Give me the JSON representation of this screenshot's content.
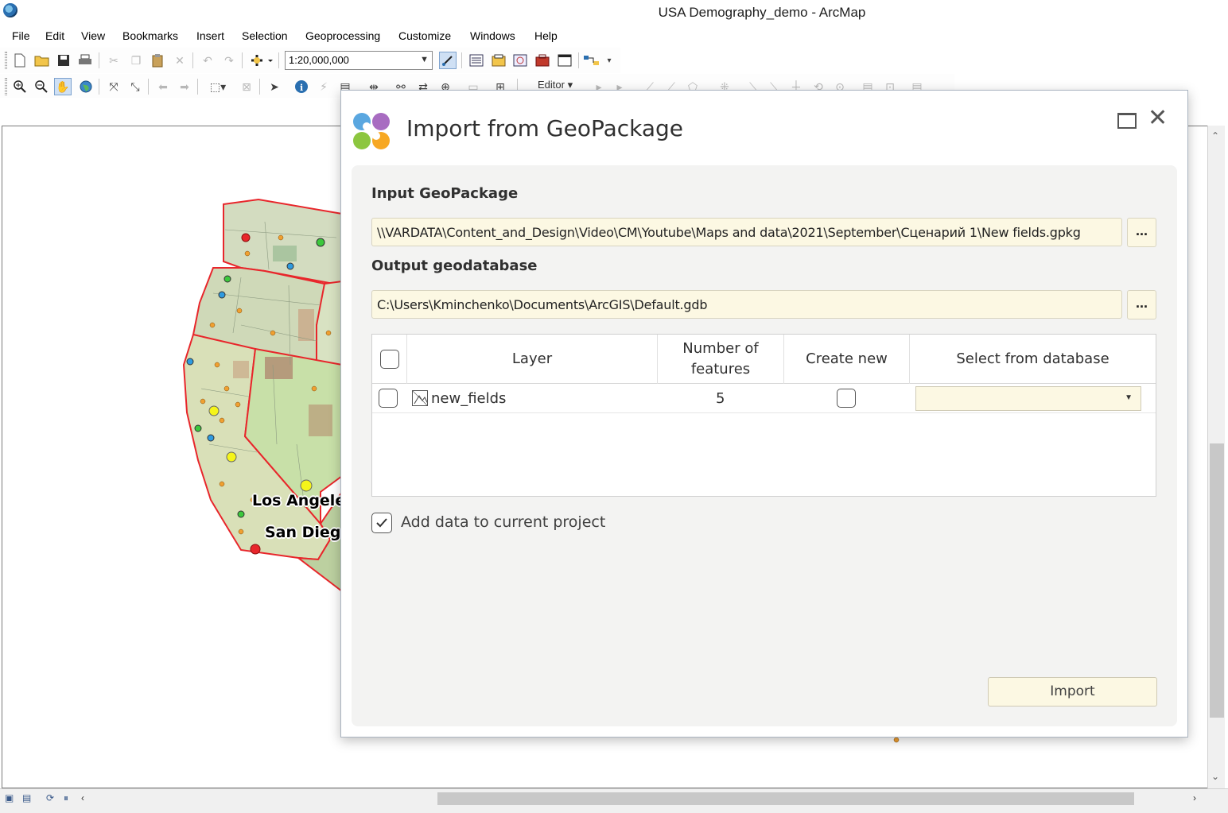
{
  "window": {
    "title": "USA Demography_demo - ArcMap"
  },
  "menu": [
    "File",
    "Edit",
    "View",
    "Bookmarks",
    "Insert",
    "Selection",
    "Geoprocessing",
    "Customize",
    "Windows",
    "Help"
  ],
  "toolbar": {
    "scale": "1:20,000,000",
    "editor_label": "Editor ▾"
  },
  "map": {
    "labels": [
      "Los Angele",
      "San Dieg"
    ]
  },
  "dialog": {
    "title": "Import from GeoPackage",
    "input_label": "Input GeoPackage",
    "input_path": "\\\\VARDATA\\Content_and_Design\\Video\\CM\\Youtube\\Maps and data\\2021\\September\\Сценарий 1\\New fields.gpkg",
    "output_label": "Output geodatabase",
    "output_path": "C:\\Users\\Kminchenko\\Documents\\ArcGIS\\Default.gdb",
    "browse": "...",
    "columns": {
      "layer": "Layer",
      "num_features": "Number of features",
      "create_new": "Create new",
      "select_db": "Select from database"
    },
    "rows": [
      {
        "layer": "new_fields",
        "features": "5",
        "create_new": false,
        "selected": false,
        "db": ""
      }
    ],
    "add_to_project_label": "Add data to current project",
    "add_to_project_checked": true,
    "import_button": "Import"
  },
  "colors": {
    "accent_field": "#fcf8e3",
    "panel": "#f3f3f2",
    "state_border": "#e8262b"
  }
}
